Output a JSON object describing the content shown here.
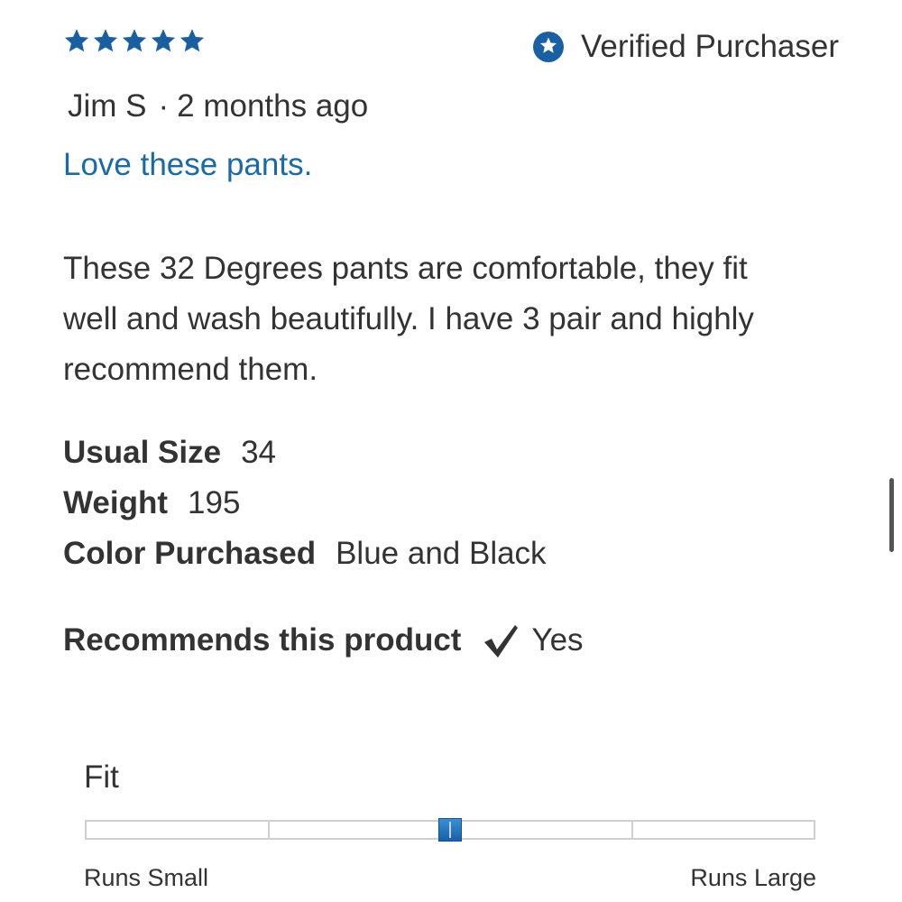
{
  "review": {
    "rating": 5,
    "rating_max": 5,
    "star_color": "#1a5fa4",
    "verified_label": "Verified Purchaser",
    "verified_icon": "star-badge-icon",
    "author": "Jim S",
    "separator": "·",
    "time_ago": "2 months ago",
    "title": "Love these pants.",
    "title_color": "#1a6aa8",
    "body_lines": [
      "These 32 Degrees pants are comfortable, they fit",
      "well and wash beautifully. I have 3 pair and highly",
      "recommend them."
    ]
  },
  "attributes": [
    {
      "label": "Usual Size",
      "value": "34"
    },
    {
      "label": "Weight",
      "value": "195"
    },
    {
      "label": "Color Purchased",
      "value": "Blue and Black"
    }
  ],
  "recommend": {
    "label": "Recommends this product",
    "icon": "checkmark-icon",
    "value": "Yes"
  },
  "fit": {
    "label": "Fit",
    "min_label": "Runs Small",
    "max_label": "Runs Large",
    "segments": 4,
    "value_fraction": 0.5,
    "accent_color": "#1f6fba"
  }
}
